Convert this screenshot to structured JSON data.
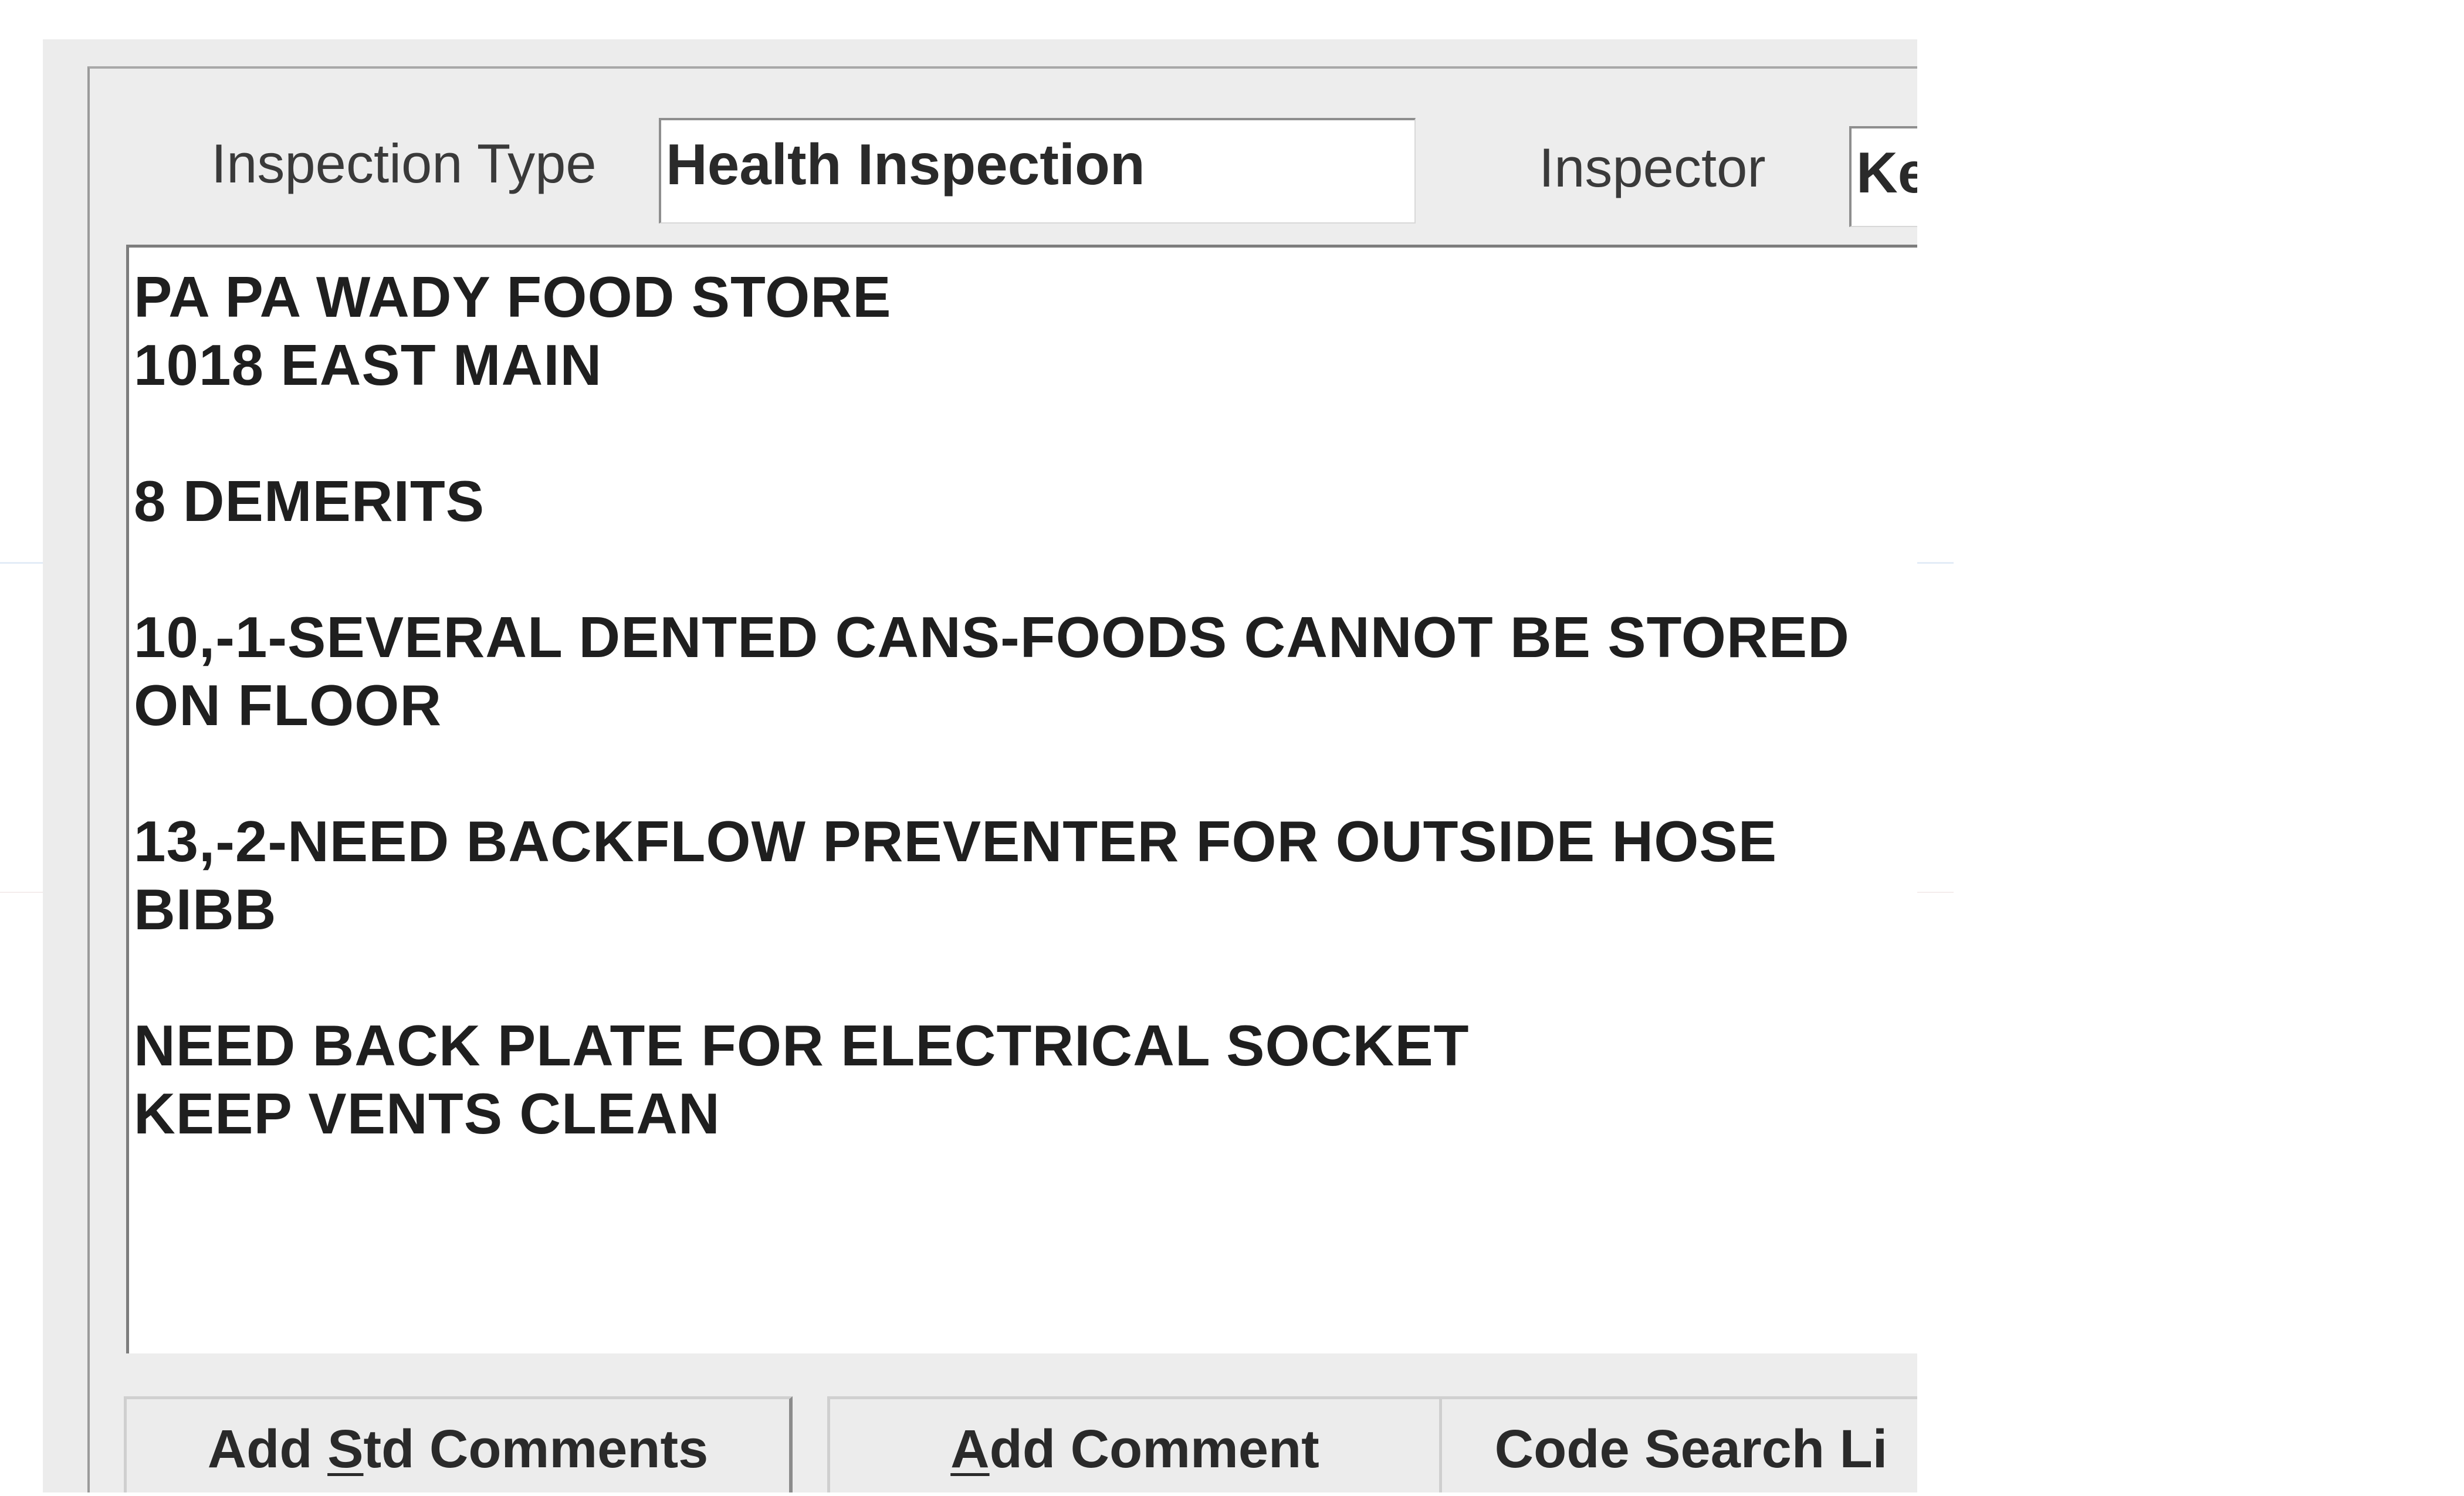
{
  "dialog": {
    "inspection_type": {
      "label": "Inspection Type",
      "value": "Health Inspection"
    },
    "inspector": {
      "label": "Inspector",
      "value": "Ke"
    },
    "comments": {
      "lines": [
        "PA PA WADY FOOD STORE",
        "1018 EAST MAIN",
        "",
        "8 DEMERITS",
        "",
        "10,-1-SEVERAL DENTED CANS-FOODS CANNOT BE STORED",
        "ON FLOOR",
        "",
        "13,-2-NEED BACKFLOW PREVENTER FOR OUTSIDE HOSE",
        "BIBB",
        "",
        "NEED BACK PLATE FOR ELECTRICAL SOCKET",
        "KEEP VENTS CLEAN"
      ]
    },
    "buttons": {
      "add_std_comments": {
        "pre": "Add ",
        "mnemonic": "S",
        "post": "td Comments"
      },
      "add_comment": {
        "pre": "",
        "mnemonic": "A",
        "post": "dd Comment"
      },
      "code_search": {
        "label": "Code Search Li"
      }
    }
  }
}
